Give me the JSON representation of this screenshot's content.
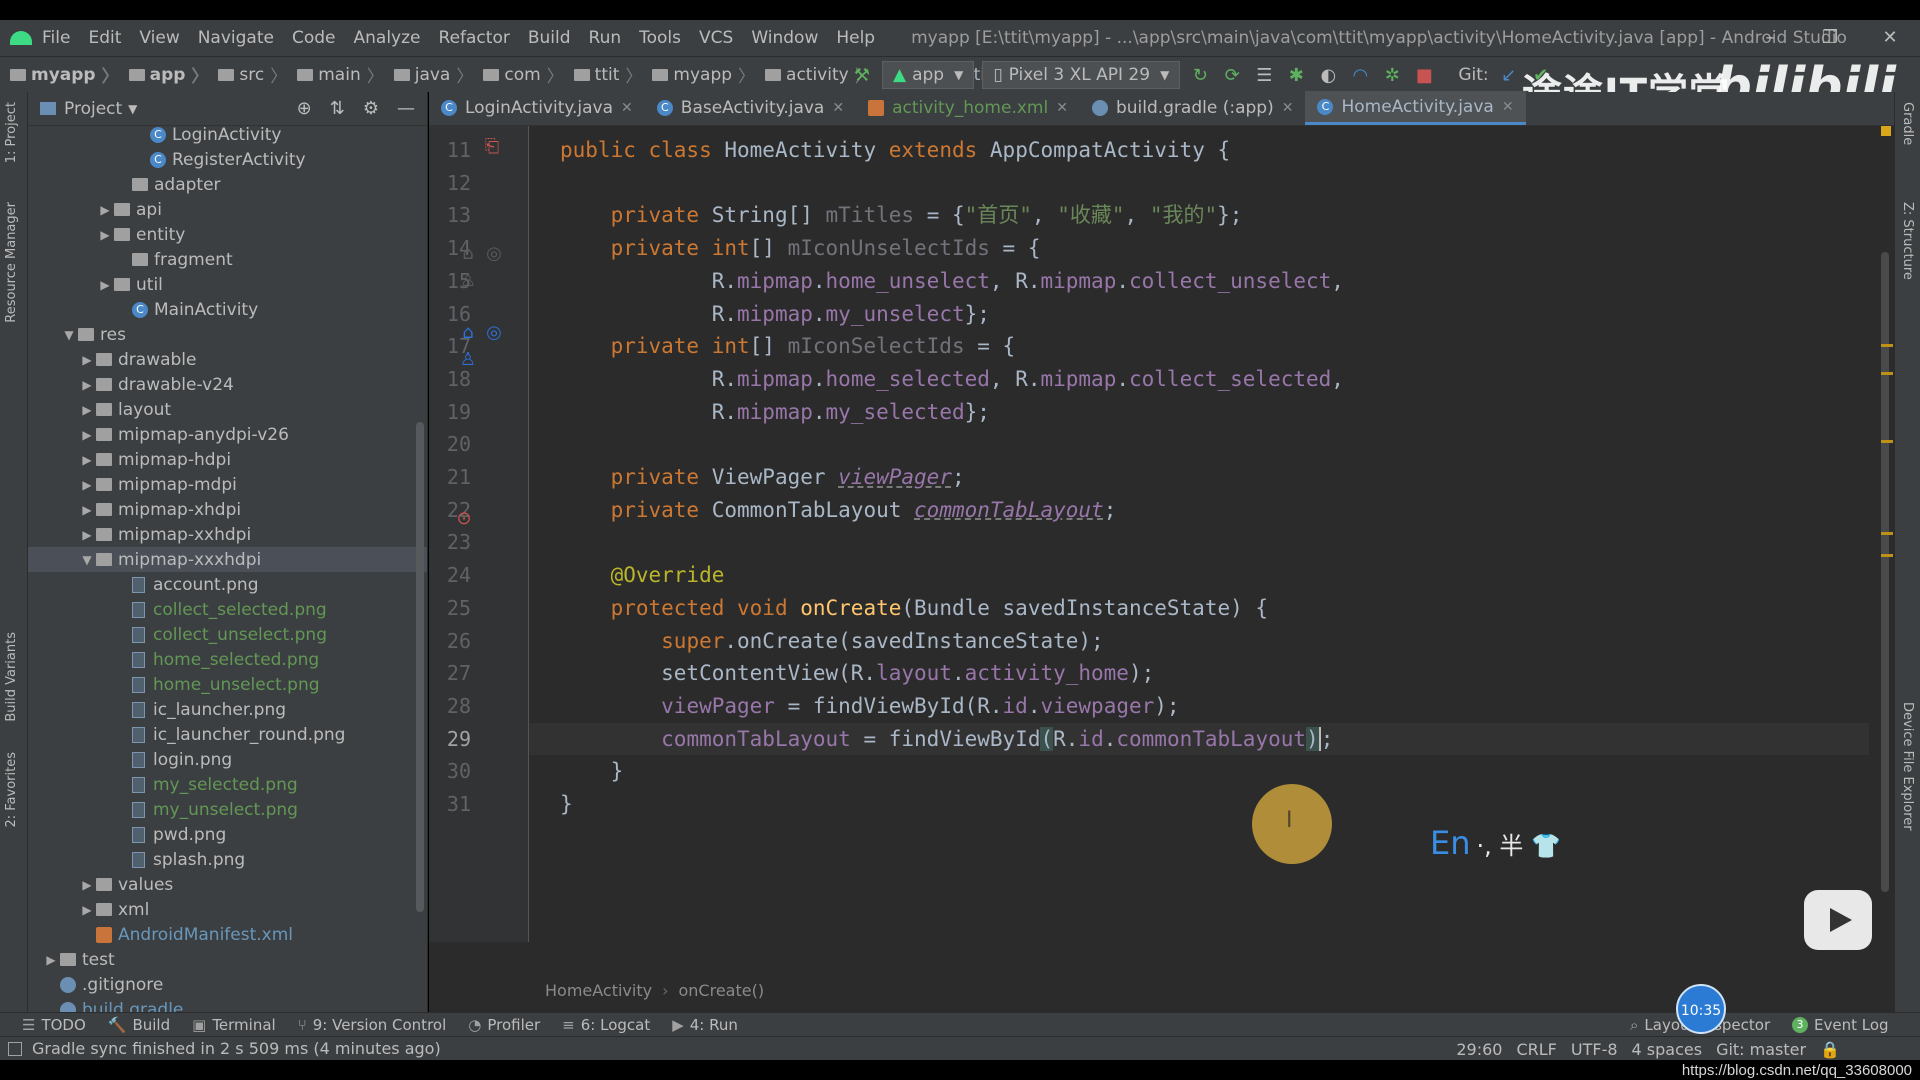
{
  "window": {
    "menu": [
      "File",
      "Edit",
      "View",
      "Navigate",
      "Code",
      "Analyze",
      "Refactor",
      "Build",
      "Run",
      "Tools",
      "VCS",
      "Window",
      "Help"
    ],
    "title": "myapp [E:\\ttit\\myapp] - ...\\app\\src\\main\\java\\com\\ttit\\myapp\\activity\\HomeActivity.java [app] - Android Studio"
  },
  "breadcrumbs": [
    "myapp",
    "app",
    "src",
    "main",
    "java",
    "com",
    "ttit",
    "myapp",
    "activity",
    "HomeActivity"
  ],
  "toolbar": {
    "run_config": "app",
    "device": "Pixel 3 XL API 29",
    "git_label": "Git:"
  },
  "watermark": {
    "logo_text": "途途IT学堂",
    "bili": "bilibili",
    "url": "https://blog.csdn.net/qq_33608000"
  },
  "project_panel": {
    "title": "Project",
    "tree": [
      {
        "label": "LoginActivity",
        "icon": "class",
        "indent": 8,
        "arrow": "",
        "style": ""
      },
      {
        "label": "RegisterActivity",
        "icon": "class",
        "indent": 8,
        "arrow": "",
        "style": ""
      },
      {
        "label": "adapter",
        "icon": "folder",
        "indent": 7,
        "arrow": "",
        "style": ""
      },
      {
        "label": "api",
        "icon": "folder",
        "indent": 6,
        "arrow": "▶",
        "style": ""
      },
      {
        "label": "entity",
        "icon": "folder",
        "indent": 6,
        "arrow": "▶",
        "style": ""
      },
      {
        "label": "fragment",
        "icon": "folder",
        "indent": 7,
        "arrow": "",
        "style": ""
      },
      {
        "label": "util",
        "icon": "folder",
        "indent": 6,
        "arrow": "▶",
        "style": ""
      },
      {
        "label": "MainActivity",
        "icon": "class",
        "indent": 7,
        "arrow": "",
        "style": ""
      },
      {
        "label": "res",
        "icon": "folder",
        "indent": 4,
        "arrow": "▼",
        "style": ""
      },
      {
        "label": "drawable",
        "icon": "folder",
        "indent": 5,
        "arrow": "▶",
        "style": ""
      },
      {
        "label": "drawable-v24",
        "icon": "folder",
        "indent": 5,
        "arrow": "▶",
        "style": ""
      },
      {
        "label": "layout",
        "icon": "folder",
        "indent": 5,
        "arrow": "▶",
        "style": ""
      },
      {
        "label": "mipmap-anydpi-v26",
        "icon": "folder",
        "indent": 5,
        "arrow": "▶",
        "style": ""
      },
      {
        "label": "mipmap-hdpi",
        "icon": "folder",
        "indent": 5,
        "arrow": "▶",
        "style": ""
      },
      {
        "label": "mipmap-mdpi",
        "icon": "folder",
        "indent": 5,
        "arrow": "▶",
        "style": ""
      },
      {
        "label": "mipmap-xhdpi",
        "icon": "folder",
        "indent": 5,
        "arrow": "▶",
        "style": ""
      },
      {
        "label": "mipmap-xxhdpi",
        "icon": "folder",
        "indent": 5,
        "arrow": "▶",
        "style": ""
      },
      {
        "label": "mipmap-xxxhdpi",
        "icon": "folder",
        "indent": 5,
        "arrow": "▼",
        "style": "selected"
      },
      {
        "label": "account.png",
        "icon": "image",
        "indent": 7,
        "arrow": "",
        "style": ""
      },
      {
        "label": "collect_selected.png",
        "icon": "image",
        "indent": 7,
        "arrow": "",
        "style": "vcs-added"
      },
      {
        "label": "collect_unselect.png",
        "icon": "image",
        "indent": 7,
        "arrow": "",
        "style": "vcs-added"
      },
      {
        "label": "home_selected.png",
        "icon": "image",
        "indent": 7,
        "arrow": "",
        "style": "vcs-added"
      },
      {
        "label": "home_unselect.png",
        "icon": "image",
        "indent": 7,
        "arrow": "",
        "style": "vcs-added"
      },
      {
        "label": "ic_launcher.png",
        "icon": "image",
        "indent": 7,
        "arrow": "",
        "style": ""
      },
      {
        "label": "ic_launcher_round.png",
        "icon": "image",
        "indent": 7,
        "arrow": "",
        "style": ""
      },
      {
        "label": "login.png",
        "icon": "image",
        "indent": 7,
        "arrow": "",
        "style": ""
      },
      {
        "label": "my_selected.png",
        "icon": "image",
        "indent": 7,
        "arrow": "",
        "style": "vcs-added"
      },
      {
        "label": "my_unselect.png",
        "icon": "image",
        "indent": 7,
        "arrow": "",
        "style": "vcs-added"
      },
      {
        "label": "pwd.png",
        "icon": "image",
        "indent": 7,
        "arrow": "",
        "style": ""
      },
      {
        "label": "splash.png",
        "icon": "image",
        "indent": 7,
        "arrow": "",
        "style": ""
      },
      {
        "label": "values",
        "icon": "folder",
        "indent": 5,
        "arrow": "▶",
        "style": ""
      },
      {
        "label": "xml",
        "icon": "folder",
        "indent": 5,
        "arrow": "▶",
        "style": ""
      },
      {
        "label": "AndroidManifest.xml",
        "icon": "manifest",
        "indent": 5,
        "arrow": "",
        "style": "vcs-new"
      },
      {
        "label": "test",
        "icon": "folder",
        "indent": 3,
        "arrow": "▶",
        "style": ""
      },
      {
        "label": ".gitignore",
        "icon": "gradle",
        "indent": 3,
        "arrow": "",
        "style": ""
      },
      {
        "label": "build.gradle",
        "icon": "gradle",
        "indent": 3,
        "arrow": "",
        "style": "vcs-new"
      }
    ]
  },
  "tabs": [
    {
      "label": "LoginActivity.java",
      "icon": "class",
      "active": false
    },
    {
      "label": "BaseActivity.java",
      "icon": "class",
      "active": false
    },
    {
      "label": "activity_home.xml",
      "icon": "xml",
      "active": false
    },
    {
      "label": "build.gradle (:app)",
      "icon": "gradle",
      "active": false
    },
    {
      "label": "HomeActivity.java",
      "icon": "class",
      "active": true
    }
  ],
  "editor": {
    "current_line": 29,
    "lines": [
      {
        "no": 11,
        "html": "<span class=\"kw\">public class </span>HomeActivity <span class=\"kw\">extends </span>AppCompatActivity {"
      },
      {
        "no": 12,
        "html": ""
      },
      {
        "no": 13,
        "html": "    <span class=\"kw\">private </span>String[] <span class=\"gray\">mTitles</span> = {<span class=\"str\">\"首页\"</span>, <span class=\"str\">\"收藏\"</span>, <span class=\"str\">\"我的\"</span>};"
      },
      {
        "no": 14,
        "html": "    <span class=\"kw\">private int</span>[] <span class=\"gray\">mIconUnselectIds</span> = {"
      },
      {
        "no": 15,
        "html": "            R.<span class=\"field\">mipmap</span>.<span class=\"field\">home_unselect</span>, R.<span class=\"field\">mipmap</span>.<span class=\"field\">collect_unselect</span>,"
      },
      {
        "no": 16,
        "html": "            R.<span class=\"field\">mipmap</span>.<span class=\"field\">my_unselect</span>};"
      },
      {
        "no": 17,
        "html": "    <span class=\"kw\">private int</span>[] <span class=\"gray\">mIconSelectIds</span> = {"
      },
      {
        "no": 18,
        "html": "            R.<span class=\"field\">mipmap</span>.<span class=\"field\">home_selected</span>, R.<span class=\"field\">mipmap</span>.<span class=\"field\">collect_selected</span>,"
      },
      {
        "no": 19,
        "html": "            R.<span class=\"field\">mipmap</span>.<span class=\"field\">my_selected</span>};"
      },
      {
        "no": 20,
        "html": ""
      },
      {
        "no": 21,
        "html": "    <span class=\"kw\">private </span>ViewPager <span class=\"unused\">viewPager</span>;"
      },
      {
        "no": 22,
        "html": "    <span class=\"kw\">private </span>CommonTabLayout <span class=\"unused\">commonTabLayout</span>;"
      },
      {
        "no": 23,
        "html": ""
      },
      {
        "no": 24,
        "html": "    <span class=\"ann\">@Override</span>"
      },
      {
        "no": 25,
        "html": "    <span class=\"kw\">protected void </span><span class=\"fn\">onCreate</span>(Bundle savedInstanceState) {"
      },
      {
        "no": 26,
        "html": "        <span class=\"kw\">super</span>.onCreate(savedInstanceState);"
      },
      {
        "no": 27,
        "html": "        setContentView(R.<span class=\"field\">layout</span>.<span class=\"field\">activity_home</span>);"
      },
      {
        "no": 28,
        "html": "        <span class=\"field\">viewPager</span> = findViewById(R.<span class=\"field\">id</span>.<span class=\"field\">viewpager</span>);"
      },
      {
        "no": 29,
        "html": "        <span class=\"field\">commonTabLayout</span> = findViewById<span class=\"bracket-match\">(</span>R.<span class=\"field\">id</span>.<span class=\"field\">commonTabLayout</span><span class=\"bracket-match caret-hl\">)</span>;"
      },
      {
        "no": 30,
        "html": "    }"
      },
      {
        "no": 31,
        "html": "}"
      }
    ]
  },
  "editor_breadcrumb": [
    "HomeActivity",
    "onCreate()"
  ],
  "ime": {
    "lang": "En",
    "rest": "·, 半 👕"
  },
  "timer": "10:35",
  "tool_windows": [
    {
      "icon": "☰",
      "label": "TODO"
    },
    {
      "icon": "🔨",
      "label": "Build"
    },
    {
      "icon": "▣",
      "label": "Terminal"
    },
    {
      "icon": "⑂",
      "label": "9: Version Control"
    },
    {
      "icon": "◔",
      "label": "Profiler"
    },
    {
      "icon": "≡",
      "label": "6: Logcat"
    },
    {
      "icon": "▶",
      "label": "4: Run"
    }
  ],
  "tool_windows_right": [
    {
      "icon": "⌕",
      "label": "Layout Inspector"
    },
    {
      "icon": "3",
      "label": "Event Log"
    }
  ],
  "status": {
    "message": "Gradle sync finished in 2 s 509 ms (4 minutes ago)",
    "position": "29:60",
    "line_sep": "CRLF",
    "encoding": "UTF-8",
    "indent": "4 spaces",
    "vcs": "Git: master"
  },
  "side_labels": {
    "left": [
      "1: Project",
      "Resource Manager",
      "Build Variants",
      "2: Favorites"
    ],
    "right": [
      "Gradle",
      "Z: Structure",
      "Device File Explorer"
    ]
  }
}
